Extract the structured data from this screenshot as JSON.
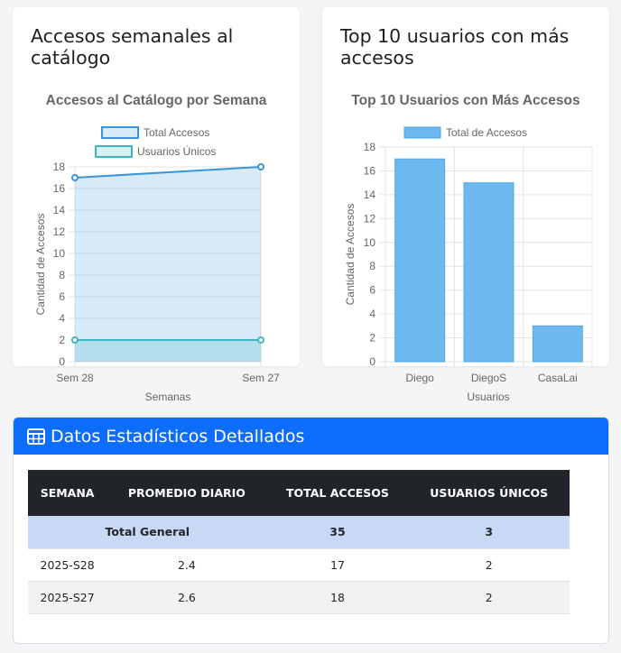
{
  "weekly_card": {
    "title": "Accesos semanales al catálogo"
  },
  "top_card": {
    "title": "Top 10 usuarios con más accesos"
  },
  "stats": {
    "header_title": "Datos Estadísticos Detallados",
    "icon": "table-icon",
    "columns": [
      "SEMANA",
      "PROMEDIO DIARIO",
      "TOTAL ACCESOS",
      "USUARIOS ÚNICOS"
    ],
    "total_row": {
      "label": "Total General",
      "promedio": "",
      "total_accesos": "35",
      "usuarios_unicos": "3"
    },
    "rows": [
      {
        "semana": "2025-S28",
        "promedio": "2.4",
        "total_accesos": "17",
        "usuarios_unicos": "2"
      },
      {
        "semana": "2025-S27",
        "promedio": "2.6",
        "total_accesos": "18",
        "usuarios_unicos": "2"
      }
    ]
  },
  "colors": {
    "primary": "#0d6efd",
    "line_total": "#3a95d9",
    "line_unicos": "#41b4c4",
    "bar": "#6cb8ef",
    "table_header": "#212529",
    "total_row": "#c8d9f6"
  },
  "chart_data": [
    {
      "type": "line",
      "title": "Accesos al Catálogo por Semana",
      "xlabel": "Semanas",
      "ylabel": "Cantidad de Accesos",
      "categories": [
        "Sem 28",
        "Sem 27"
      ],
      "series": [
        {
          "name": "Total Accesos",
          "values": [
            17,
            18
          ]
        },
        {
          "name": "Usuarios Únicos",
          "values": [
            2,
            2
          ]
        }
      ],
      "ylim": [
        0,
        18
      ],
      "yticks": [
        0,
        2,
        4,
        6,
        8,
        10,
        12,
        14,
        16,
        18
      ],
      "grid": true,
      "legend": "top"
    },
    {
      "type": "bar",
      "title": "Top 10 Usuarios con Más Accesos",
      "xlabel": "Usuarios",
      "ylabel": "Cantidad de Accesos",
      "categories": [
        "Diego",
        "DiegoS",
        "CasaLai"
      ],
      "series": [
        {
          "name": "Total de Accesos",
          "values": [
            17,
            15,
            3
          ]
        }
      ],
      "ylim": [
        0,
        18
      ],
      "yticks": [
        0,
        2,
        4,
        6,
        8,
        10,
        12,
        14,
        16,
        18
      ],
      "grid": true,
      "legend": "top"
    }
  ]
}
